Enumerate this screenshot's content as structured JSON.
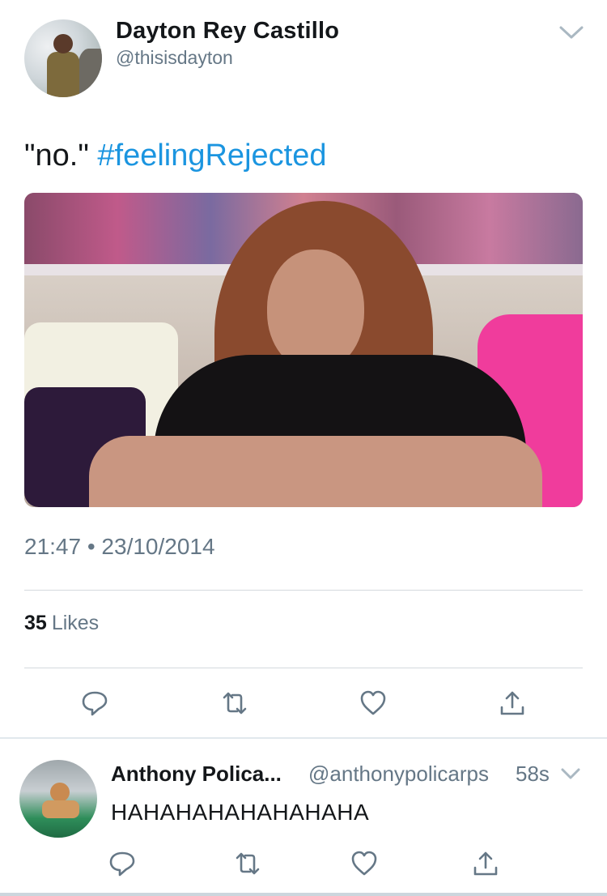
{
  "tweet": {
    "author_name": "Dayton Rey Castillo",
    "author_handle": "@thisisdayton",
    "text_plain": "\"no.\" ",
    "text_hashtag": "#feelingRejected",
    "timestamp": "21:47 • 23/10/2014",
    "likes_count": "35",
    "likes_label": "Likes"
  },
  "reply": {
    "author_name": "Anthony Polica...",
    "author_handle": "@anthonypolicarps",
    "time": "58s",
    "text": "HAHAHAHAHAHAHAHA"
  },
  "icons": {
    "reply": "reply-icon",
    "retweet": "retweet-icon",
    "like": "heart-icon",
    "share": "share-icon",
    "menu": "chevron-down-icon"
  },
  "colors": {
    "link": "#1b95e0",
    "secondary_text": "#657786",
    "primary_text": "#14171a",
    "divider": "#d4d9de"
  }
}
